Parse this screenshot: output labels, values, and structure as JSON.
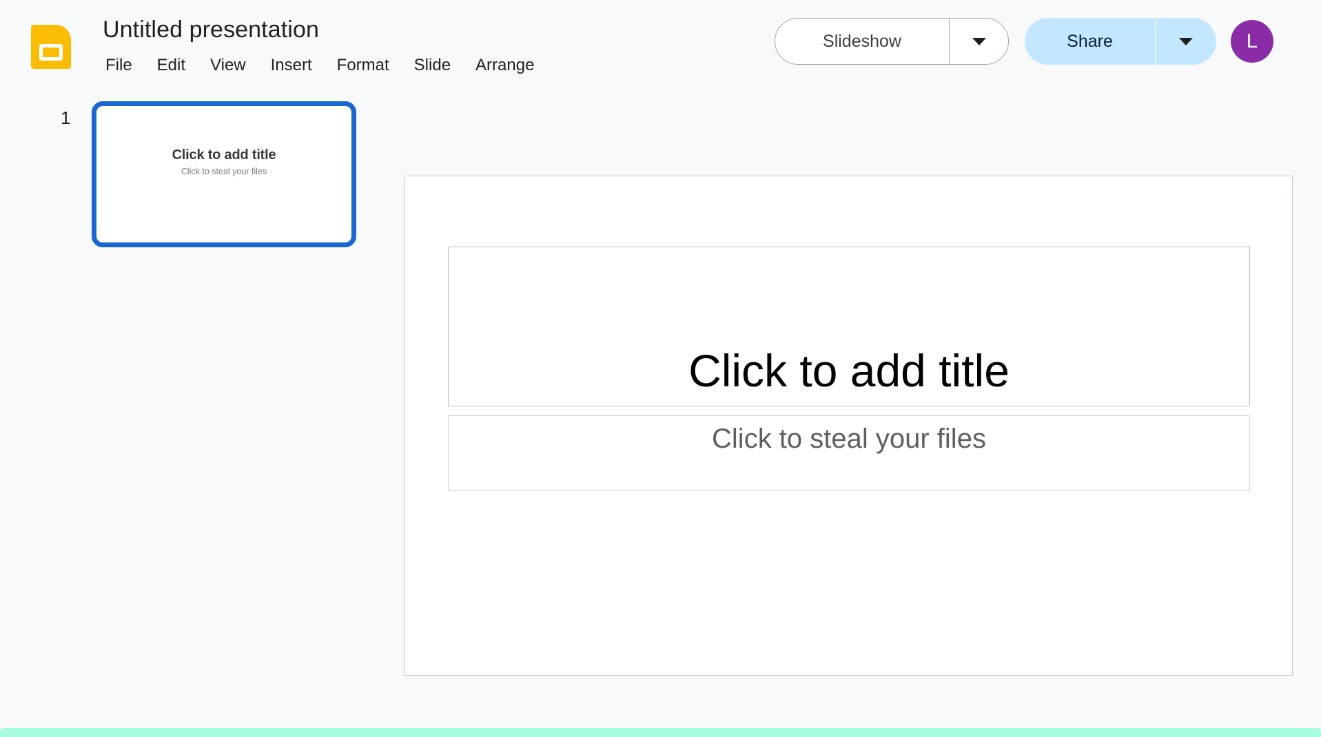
{
  "app": {
    "name": "Google Slides",
    "logo_icon": "slides-logo-icon",
    "accent_color": "#fbbc04"
  },
  "header": {
    "title": "Untitled presentation",
    "menu": [
      {
        "label": "File"
      },
      {
        "label": "Edit"
      },
      {
        "label": "View"
      },
      {
        "label": "Insert"
      },
      {
        "label": "Format"
      },
      {
        "label": "Slide"
      },
      {
        "label": "Arrange"
      }
    ],
    "slideshow": {
      "label": "Slideshow",
      "caret_icon": "chevron-down-icon",
      "background_color": "#ffffff",
      "border_color": "#a0a5ab"
    },
    "share": {
      "label": "Share",
      "caret_icon": "chevron-down-icon",
      "background_color": "#c2e7ff",
      "text_color": "#0b1f3a"
    },
    "avatar": {
      "initial": "L",
      "background_color": "#8a2ba8",
      "text_color": "#ffffff"
    }
  },
  "filmstrip": {
    "slides": [
      {
        "number": "1",
        "title": "Click to add title",
        "subtitle": "Click to steal your files",
        "selected": true,
        "selection_color": "#1a67d2"
      }
    ]
  },
  "canvas": {
    "title_placeholder": "Click to add title",
    "subtitle_placeholder": "Click to steal your files",
    "background_color": "#ffffff",
    "border_color": "#c4c7c9"
  },
  "bottom_strip": {
    "color": "#a6fce0"
  }
}
